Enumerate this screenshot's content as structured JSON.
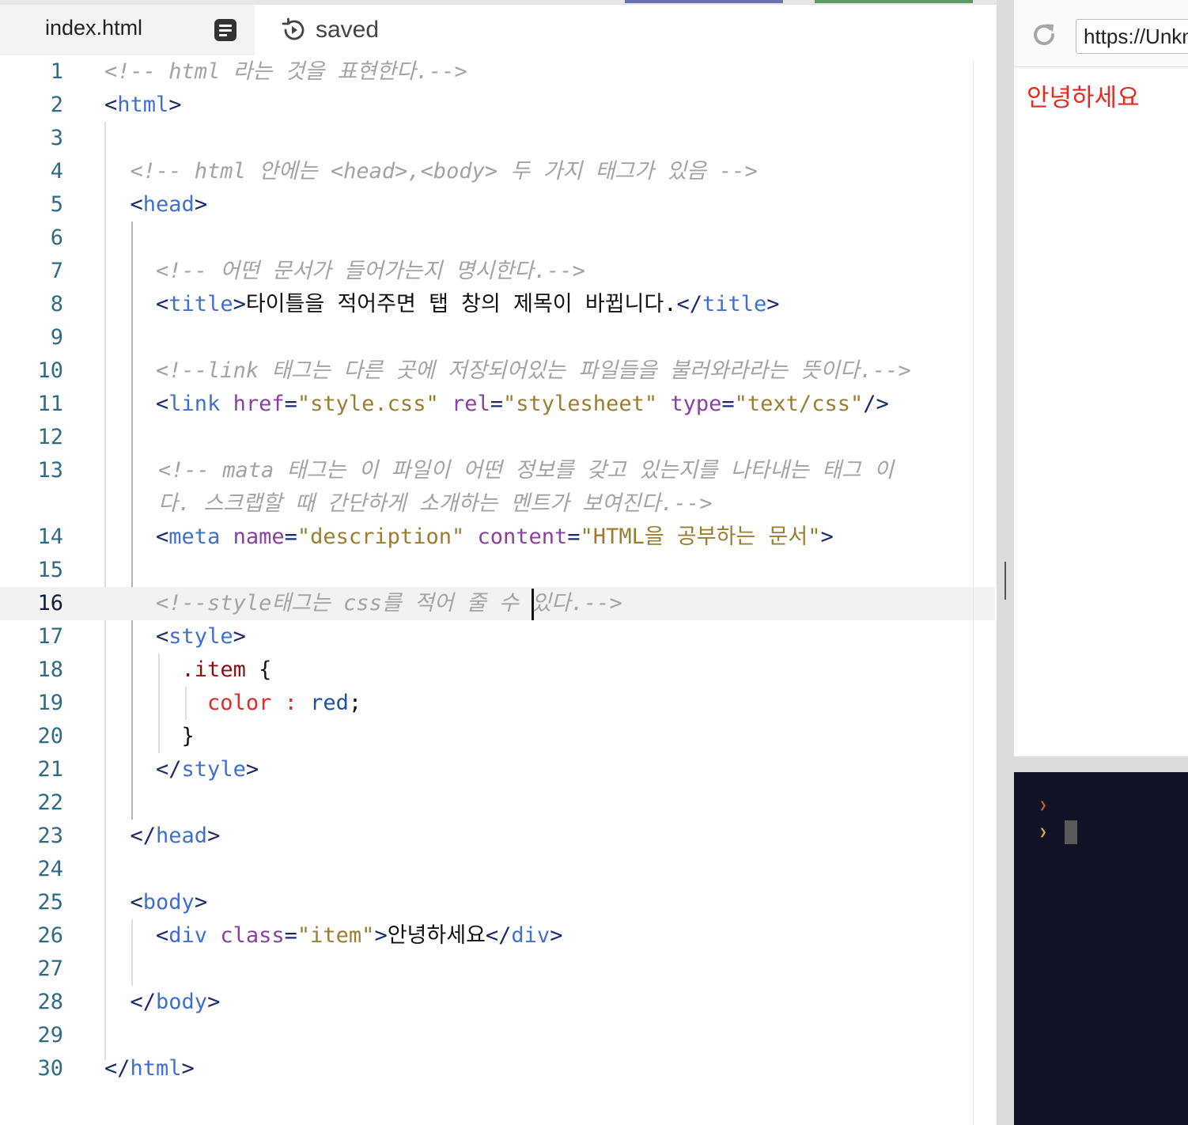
{
  "tab": {
    "filename": "index.html",
    "doc_icon": "document-icon",
    "status_icon": "history-icon",
    "status": "saved"
  },
  "preview": {
    "refresh_icon": "refresh-icon",
    "url": "https://Unknown",
    "content": "안녕하세요"
  },
  "console": {
    "prompt_symbol": "❯"
  },
  "editor": {
    "active_line": 16,
    "lines": [
      {
        "n": "1",
        "segments": [
          [
            "c",
            "<!-- html 라는 것을 표현한다.-->"
          ]
        ]
      },
      {
        "n": "2",
        "segments": [
          [
            "p",
            "<"
          ],
          [
            "t",
            "html"
          ],
          [
            "p",
            ">"
          ]
        ]
      },
      {
        "n": "3",
        "segments": []
      },
      {
        "n": "4",
        "segments": [
          [
            "",
            "  "
          ],
          [
            "c",
            "<!-- html 안에는 <head>,<body> 두 가지 태그가 있음 -->"
          ]
        ]
      },
      {
        "n": "5",
        "segments": [
          [
            "",
            "  "
          ],
          [
            "p",
            "<"
          ],
          [
            "t",
            "head"
          ],
          [
            "p",
            ">"
          ]
        ]
      },
      {
        "n": "6",
        "segments": []
      },
      {
        "n": "7",
        "segments": [
          [
            "",
            "    "
          ],
          [
            "c",
            "<!-- 어떤 문서가 들어가는지 명시한다.-->"
          ]
        ]
      },
      {
        "n": "8",
        "segments": [
          [
            "",
            "    "
          ],
          [
            "p",
            "<"
          ],
          [
            "t",
            "title"
          ],
          [
            "p",
            ">"
          ],
          [
            "",
            "타이틀을 적어주면 탭 창의 제목이 바뀝니다."
          ],
          [
            "p",
            "</"
          ],
          [
            "t",
            "title"
          ],
          [
            "p",
            ">"
          ]
        ]
      },
      {
        "n": "9",
        "segments": []
      },
      {
        "n": "10",
        "segments": [
          [
            "",
            "    "
          ],
          [
            "c",
            "<!--link 태그는 다른 곳에 저장되어있는 파일들을 불러와라라는 뜻이다.-->"
          ]
        ]
      },
      {
        "n": "11",
        "segments": [
          [
            "",
            "    "
          ],
          [
            "p",
            "<"
          ],
          [
            "t",
            "link"
          ],
          [
            "",
            " "
          ],
          [
            "a",
            "href"
          ],
          [
            "p",
            "="
          ],
          [
            "s",
            "\"style.css\""
          ],
          [
            "",
            " "
          ],
          [
            "a",
            "rel"
          ],
          [
            "p",
            "="
          ],
          [
            "s",
            "\"stylesheet\""
          ],
          [
            "",
            " "
          ],
          [
            "a",
            "type"
          ],
          [
            "p",
            "="
          ],
          [
            "s",
            "\"text/css\""
          ],
          [
            "p",
            "/>"
          ]
        ]
      },
      {
        "n": "12",
        "segments": []
      },
      {
        "n": "13",
        "tall": true,
        "segments": [
          [
            "c",
            "<!-- mata 태그는 이 파일이 어떤 정보를 갖고 있는지를 나타내는 태그 이다. 스크랩할 때 간단하게 소개하는 멘트가 보여진다.-->"
          ]
        ]
      },
      {
        "n": "14",
        "segments": [
          [
            "",
            "    "
          ],
          [
            "p",
            "<"
          ],
          [
            "t",
            "meta"
          ],
          [
            "",
            " "
          ],
          [
            "a",
            "name"
          ],
          [
            "p",
            "="
          ],
          [
            "s",
            "\"description\""
          ],
          [
            "",
            " "
          ],
          [
            "a",
            "content"
          ],
          [
            "p",
            "="
          ],
          [
            "s",
            "\"HTML을 공부하는 문서\""
          ],
          [
            "p",
            ">"
          ]
        ]
      },
      {
        "n": "15",
        "segments": []
      },
      {
        "n": "16",
        "segments": [
          [
            "",
            "    "
          ],
          [
            "c",
            "<!--style태그는 css를 적어 줄 수 "
          ],
          [
            "cursor",
            ""
          ],
          [
            "c",
            "있다.-->"
          ]
        ]
      },
      {
        "n": "17",
        "segments": [
          [
            "",
            "    "
          ],
          [
            "p",
            "<"
          ],
          [
            "t",
            "style"
          ],
          [
            "p",
            ">"
          ]
        ]
      },
      {
        "n": "18",
        "segments": [
          [
            "",
            "      "
          ],
          [
            "sel",
            ".item"
          ],
          [
            "",
            " {"
          ]
        ]
      },
      {
        "n": "19",
        "segments": [
          [
            "",
            "        "
          ],
          [
            "prop",
            "color"
          ],
          [
            "",
            " "
          ],
          [
            "prop",
            ":"
          ],
          [
            "",
            " "
          ],
          [
            "val",
            "red"
          ],
          [
            "",
            ";"
          ]
        ]
      },
      {
        "n": "20",
        "segments": [
          [
            "",
            "      }"
          ]
        ]
      },
      {
        "n": "21",
        "segments": [
          [
            "",
            "    "
          ],
          [
            "p",
            "</"
          ],
          [
            "t",
            "style"
          ],
          [
            "p",
            ">"
          ]
        ]
      },
      {
        "n": "22",
        "segments": []
      },
      {
        "n": "23",
        "segments": [
          [
            "",
            "  "
          ],
          [
            "p",
            "</"
          ],
          [
            "t",
            "head"
          ],
          [
            "p",
            ">"
          ]
        ]
      },
      {
        "n": "24",
        "segments": []
      },
      {
        "n": "25",
        "segments": [
          [
            "",
            "  "
          ],
          [
            "p",
            "<"
          ],
          [
            "t",
            "body"
          ],
          [
            "p",
            ">"
          ]
        ]
      },
      {
        "n": "26",
        "segments": [
          [
            "",
            "    "
          ],
          [
            "p",
            "<"
          ],
          [
            "t",
            "div"
          ],
          [
            "",
            " "
          ],
          [
            "a",
            "class"
          ],
          [
            "p",
            "="
          ],
          [
            "s",
            "\"item\""
          ],
          [
            "p",
            ">"
          ],
          [
            "",
            "안녕하세요"
          ],
          [
            "p",
            "</"
          ],
          [
            "t",
            "div"
          ],
          [
            "p",
            ">"
          ]
        ]
      },
      {
        "n": "27",
        "segments": []
      },
      {
        "n": "28",
        "segments": [
          [
            "",
            "  "
          ],
          [
            "p",
            "</"
          ],
          [
            "t",
            "body"
          ],
          [
            "p",
            ">"
          ]
        ]
      },
      {
        "n": "29",
        "segments": []
      },
      {
        "n": "30",
        "segments": [
          [
            "p",
            "</"
          ],
          [
            "t",
            "html"
          ],
          [
            "p",
            ">"
          ]
        ]
      }
    ]
  }
}
